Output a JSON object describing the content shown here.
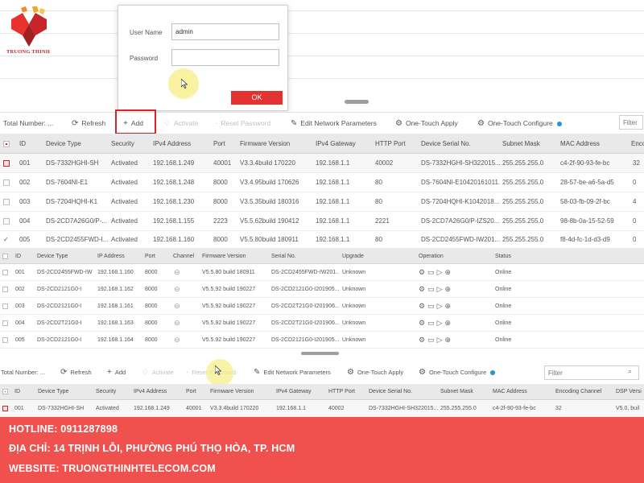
{
  "brand": {
    "logo_text": "TRUONG THINH"
  },
  "login": {
    "username_label": "User Name",
    "username_value": "admin",
    "password_label": "Password",
    "password_value": "",
    "ok_label": "OK"
  },
  "toolbar1": {
    "total_number": "Total Number: ...",
    "refresh": "Refresh",
    "add": "Add",
    "activate": "Activate",
    "reset_password": "Reset Password",
    "edit_network": "Edit Network Parameters",
    "one_touch_apply": "One-Touch Apply",
    "one_touch_configure": "One-Touch Configure",
    "filter_placeholder": "Filter"
  },
  "table1": {
    "headers": [
      "ID",
      "Device Type",
      "Security",
      "IPv4 Address",
      "Port",
      "Firmware Version",
      "IPv4 Gateway",
      "HTTP Port",
      "Device Serial No.",
      "Subnet Mask",
      "MAC Address",
      "Enco"
    ],
    "rows": [
      [
        "001",
        "DS-7332HGHI-SH",
        "Activated",
        "192.168.1.249",
        "40001",
        "V3.3.4build 170220",
        "192.168.1.1",
        "40002",
        "DS-7332HGHI-SH322015...",
        "255.255.255.0",
        "c4-2f-90-93-fe-bc",
        "32"
      ],
      [
        "002",
        "DS-7604NI-E1",
        "Activated",
        "192.168.1.248",
        "8000",
        "V3.4.95build 170626",
        "192.168.1.1",
        "80",
        "DS-7604NI-E10420161011...",
        "255.255.255.0",
        "28-57-be-a6-5a-d5",
        "0"
      ],
      [
        "003",
        "DS-7204HQHI-K1",
        "Activated",
        "192.168.1.230",
        "8000",
        "V3.5.35build 180316",
        "192.168.1.1",
        "80",
        "DS-7204HQHI-K1042018...",
        "255.255.255.0",
        "58-03-fb-09-2f-bc",
        "4"
      ],
      [
        "004",
        "DS-2CD7A26G0/P-...",
        "Activated",
        "192.168.1.155",
        "2223",
        "V5.5.62build 190412",
        "192.168.1.1",
        "2221",
        "DS-2CD7A26G0/P-IZS20...",
        "255.255.255.0",
        "98-8b-0a-15-52-59",
        "0"
      ],
      [
        "005",
        "DS-2CD2455FWD-I...",
        "Activated",
        "192.168.1.160",
        "8000",
        "V5.5.80build 180911",
        "192.168.1.1",
        "80",
        "DS-2CD2455FWD-IW201...",
        "255.255.255.0",
        "f8-4d-fc-1d-d3-d9",
        "0"
      ]
    ]
  },
  "table2": {
    "headers": [
      "ID",
      "Device Type",
      "IP Address",
      "Port",
      "Channel",
      "Firmware Version",
      "Serial No.",
      "Upgrade",
      "Operation",
      "Status"
    ],
    "rows": [
      [
        "001",
        "DS-2CD2455FWD-IW",
        "192.168.1.160",
        "8000",
        "V5.5.80 build 180911",
        "DS-2CD2455FWD-IW201...",
        "Unknown",
        "Online"
      ],
      [
        "002",
        "DS-2CD2121G0-I",
        "192.168.1.162",
        "8000",
        "V5.5.92 build 190227",
        "DS-2CD2121G0-I201905...",
        "Unknown",
        "Online"
      ],
      [
        "003",
        "DS-2CD2121G0-I",
        "192.168.1.161",
        "8000",
        "V5.5.92 build 190227",
        "DS-2CD2T21G0-I201906...",
        "Unknown",
        "Online"
      ],
      [
        "004",
        "DS-2CD2T21G0-I",
        "192.168.1.163",
        "8000",
        "V5.5.92 build 190227",
        "DS-2CD2T21G0-I201906...",
        "Unknown",
        "Online"
      ],
      [
        "005",
        "DS-2CD2121G0-I",
        "192.168.1.164",
        "8000",
        "V5.5.92 build 190227",
        "DS-2CD2121G0-I201905...",
        "Unknown",
        "Online"
      ]
    ]
  },
  "toolbar2": {
    "total_number": "Total Number: ...",
    "refresh": "Refresh",
    "add": "Add",
    "activate": "Activate",
    "reset_password": "Reset Password",
    "edit_network": "Edit Network Parameters",
    "one_touch_apply": "One-Touch Apply",
    "one_touch_configure": "One-Touch Configure",
    "filter_placeholder": "Filter"
  },
  "table3": {
    "headers": [
      "ID",
      "Device Type",
      "Security",
      "IPv4 Address",
      "Port",
      "Firmware Version",
      "IPv4 Gateway",
      "HTTP Port",
      "Device Serial No.",
      "Subnet Mask",
      "MAC Address",
      "Encoding Channel",
      "DSP Versi"
    ],
    "rows": [
      [
        "001",
        "DS-7332HGHI-SH",
        "Activated",
        "192.168.1.249",
        "40001",
        "V3.3.4build 170220",
        "192.168.1.1",
        "40002",
        "DS-7332HGHI-SH322015...",
        "255.255.255.0",
        "c4-2f-90-93-fe-bc",
        "32",
        "V5.0, buil"
      ]
    ]
  },
  "footer": {
    "hotline": "HOTLINE: 0911287898",
    "address": "ĐỊA CHỈ: 14 TRỊNH LỖI, PHƯỜNG PHÚ THỌ HÒA, TP. HCM",
    "website": "WEBSITE: TRUONGTHINHTELECOM.COM"
  },
  "colors": {
    "accent_red": "#e3332e",
    "banner_red": "#f0514e",
    "highlight_yellow": "#f5ee82",
    "info_blue": "#2d8fd5"
  },
  "icons": [
    "refresh-icon",
    "add-icon",
    "activate-icon",
    "reset-password-icon",
    "edit-network-icon",
    "one-touch-apply-icon",
    "one-touch-configure-icon",
    "info-dot-icon",
    "search-icon",
    "settings-icon",
    "monitor-icon",
    "play-icon",
    "web-icon",
    "cursor-icon"
  ]
}
